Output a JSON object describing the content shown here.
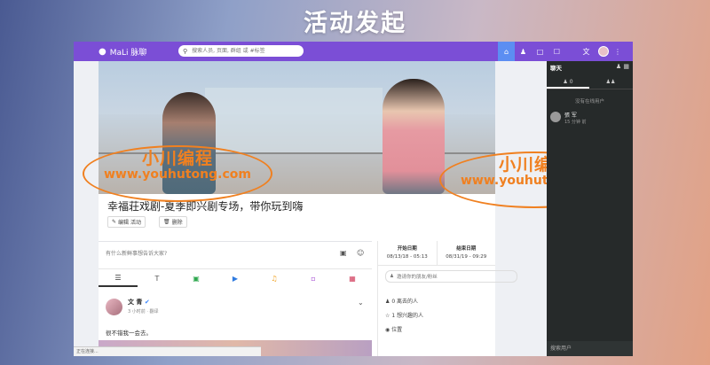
{
  "banner": {
    "title": "活动发起"
  },
  "app": {
    "logo": "MaLi 脉聊",
    "search_placeholder": "搜索人员, 页面, 群组 或 #标签",
    "colors": {
      "topbar": "#7b4ed6",
      "accent": "#5c8ef2"
    }
  },
  "event": {
    "title": "幸福荘戏剧-夏季即兴剧专场，带你玩到嗨",
    "edit_label": "编辑 活动",
    "delete_label": "删除",
    "post_placeholder": "有什么新鲜事想告诉大家?",
    "start": {
      "label": "开始日期",
      "value": "08/13/18 - 05:13"
    },
    "end": {
      "label": "结束日期",
      "value": "08/31/19 - 09:29"
    },
    "invite_placeholder": "邀请你的朋友/粉丝",
    "going": "0 离去的人",
    "interested": "1 想兴趣的人",
    "location": "位置"
  },
  "feed": {
    "name": "文 青",
    "time": "3 小时前 · 翻译",
    "text": "很不错我一会去。"
  },
  "chat": {
    "title": "聊天",
    "tab_online": "0",
    "no_online": "没有在线用户",
    "contact_name": "張 军",
    "contact_time": "15 分钟 前",
    "search": "搜索用户"
  },
  "status_bar": "正在连接...",
  "watermark": {
    "line1": "小川编程",
    "line2": "www.youhutong.com"
  }
}
